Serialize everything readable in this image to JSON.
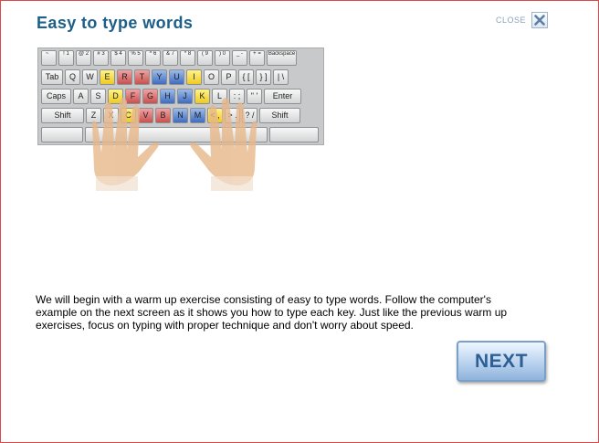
{
  "header": {
    "title": "Easy to type words"
  },
  "close_button": {
    "label": "CLOSE"
  },
  "keyboard": {
    "row1": [
      {
        "t": "~ `",
        "s": ""
      },
      {
        "t": "! 1",
        "s": ""
      },
      {
        "t": "@ 2",
        "s": ""
      },
      {
        "t": "# 3",
        "s": ""
      },
      {
        "t": "$ 4",
        "s": ""
      },
      {
        "t": "% 5",
        "s": ""
      },
      {
        "t": "^ 6",
        "s": ""
      },
      {
        "t": "& 7",
        "s": ""
      },
      {
        "t": "* 8",
        "s": ""
      },
      {
        "t": "( 9",
        "s": ""
      },
      {
        "t": ") 0",
        "s": ""
      },
      {
        "t": "_ -",
        "s": ""
      },
      {
        "t": "+ =",
        "s": ""
      },
      {
        "t": "Backspace",
        "s": ""
      }
    ],
    "row2": [
      {
        "t": "Tab",
        "s": ""
      },
      {
        "t": "Q",
        "s": ""
      },
      {
        "t": "W",
        "s": ""
      },
      {
        "t": "E",
        "s": "y"
      },
      {
        "t": "R",
        "s": "r"
      },
      {
        "t": "T",
        "s": "r"
      },
      {
        "t": "Y",
        "s": "b"
      },
      {
        "t": "U",
        "s": "b"
      },
      {
        "t": "I",
        "s": "y"
      },
      {
        "t": "O",
        "s": ""
      },
      {
        "t": "P",
        "s": ""
      },
      {
        "t": "{ [",
        "s": ""
      },
      {
        "t": "} ]",
        "s": ""
      },
      {
        "t": "| \\",
        "s": ""
      }
    ],
    "row3": [
      {
        "t": "Caps",
        "s": ""
      },
      {
        "t": "A",
        "s": ""
      },
      {
        "t": "S",
        "s": ""
      },
      {
        "t": "D",
        "s": "y"
      },
      {
        "t": "F",
        "s": "r"
      },
      {
        "t": "G",
        "s": "r"
      },
      {
        "t": "H",
        "s": "b"
      },
      {
        "t": "J",
        "s": "b"
      },
      {
        "t": "K",
        "s": "y"
      },
      {
        "t": "L",
        "s": ""
      },
      {
        "t": ": ;",
        "s": ""
      },
      {
        "t": "\" '",
        "s": ""
      },
      {
        "t": "Enter",
        "s": ""
      }
    ],
    "row4": [
      {
        "t": "Shift",
        "s": ""
      },
      {
        "t": "Z",
        "s": ""
      },
      {
        "t": "X",
        "s": ""
      },
      {
        "t": "C",
        "s": "y"
      },
      {
        "t": "V",
        "s": "r"
      },
      {
        "t": "B",
        "s": "r"
      },
      {
        "t": "N",
        "s": "b"
      },
      {
        "t": "M",
        "s": "b"
      },
      {
        "t": "< ,",
        "s": "y"
      },
      {
        "t": "> .",
        "s": ""
      },
      {
        "t": "? /",
        "s": ""
      },
      {
        "t": "Shift",
        "s": ""
      }
    ]
  },
  "instructions": "We will begin with a warm up exercise consisting of easy to type words. Follow the computer's example on the next screen as it shows you how to type each key. Just like the previous warm up exercises, focus on typing with proper technique and don't worry about speed.",
  "next_button": {
    "label": "NEXT"
  }
}
